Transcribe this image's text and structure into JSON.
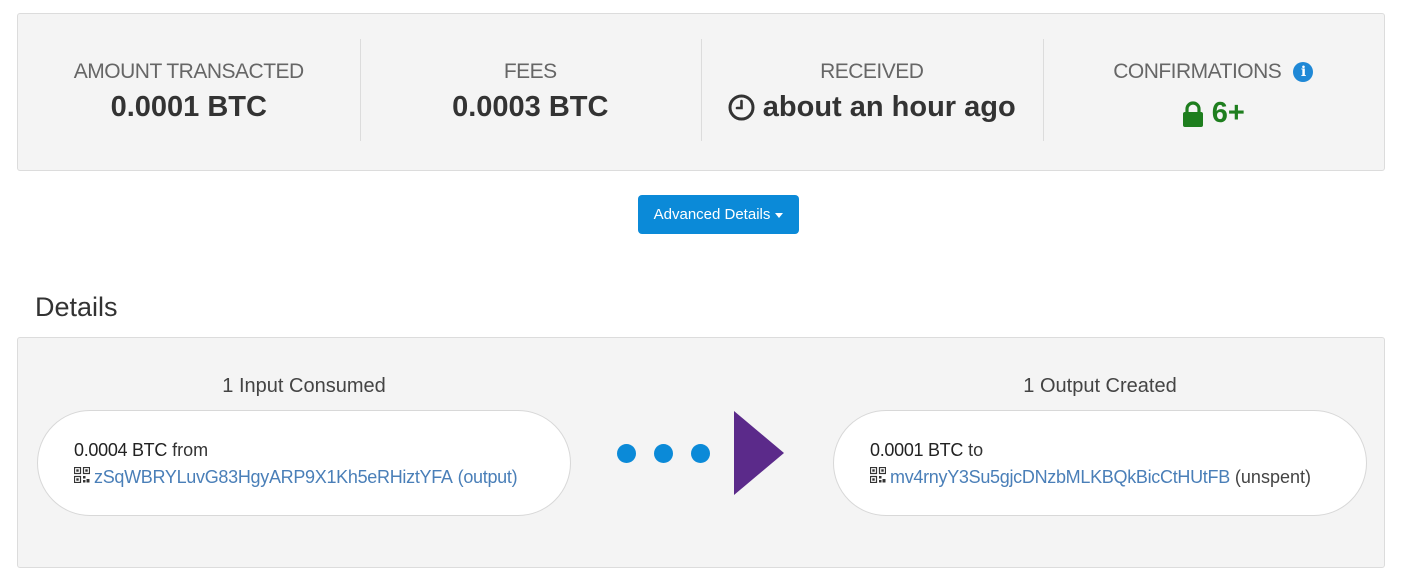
{
  "summary": {
    "amount": {
      "label": "AMOUNT TRANSACTED",
      "value": "0.0001 BTC"
    },
    "fees": {
      "label": "FEES",
      "value": "0.0003 BTC"
    },
    "received": {
      "label": "RECEIVED",
      "value": "about an hour ago",
      "icon": "clock-icon"
    },
    "confirmations": {
      "label": "CONFIRMATIONS",
      "value": "6+",
      "icon": "lock-icon",
      "info_icon": "i",
      "color": "#1e7e1e"
    }
  },
  "advanced_button": {
    "label": "Advanced Details",
    "color": "#0b8ad8"
  },
  "details": {
    "heading": "Details",
    "inputs": {
      "title": "1 Input Consumed",
      "item": {
        "amount": "0.0004 BTC",
        "direction": "from",
        "address": "zSqWBRYLuvG83HgyARP9X1Kh5eRHiztYFA",
        "status": "(output)"
      }
    },
    "outputs": {
      "title": "1 Output Created",
      "item": {
        "amount": "0.0001 BTC",
        "direction": "to",
        "address": "mv4rnyY3Su5gjcDNzbMLKBQkBicCtHUtFB",
        "status": "(unspent)"
      }
    },
    "flow": {
      "dot_color": "#0b8ad8",
      "arrow_color": "#5b2a8a"
    }
  }
}
